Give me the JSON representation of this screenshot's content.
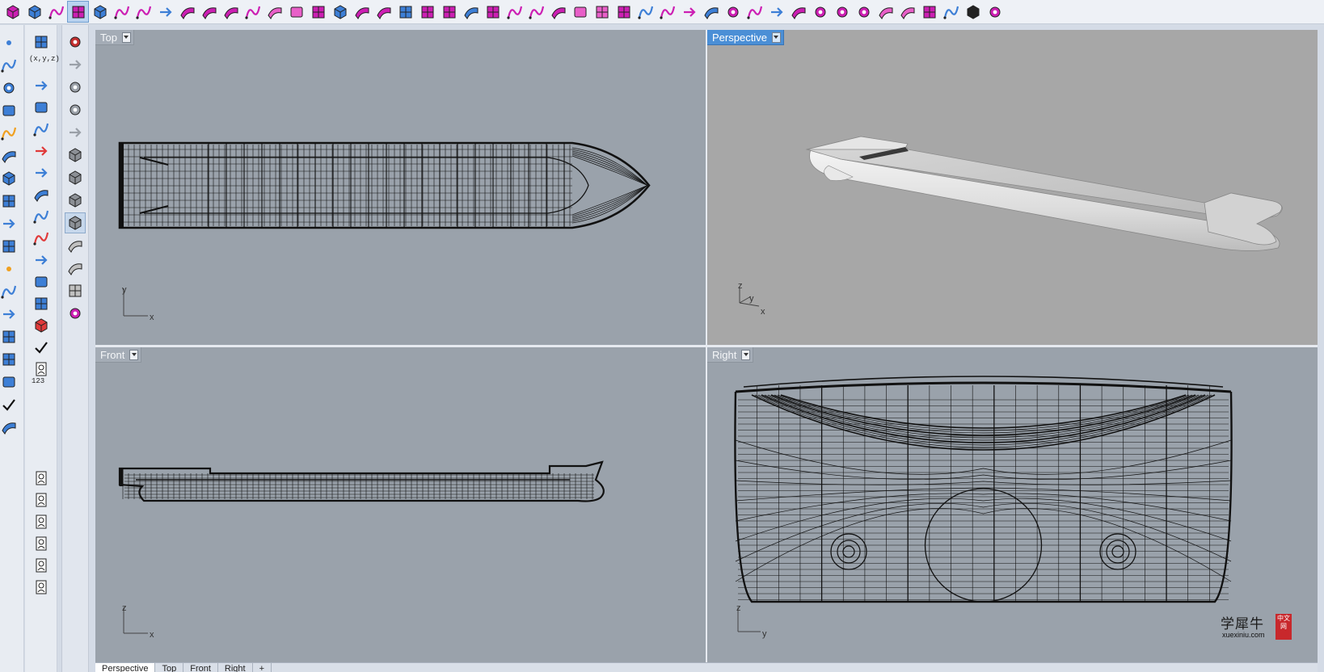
{
  "viewports": {
    "top": {
      "label": "Top",
      "axis_x": "x",
      "axis_y": "y"
    },
    "perspective": {
      "label": "Perspective",
      "axis_x": "x",
      "axis_y": "y",
      "axis_z": "z"
    },
    "front": {
      "label": "Front",
      "axis_x": "x",
      "axis_z": "z"
    },
    "right": {
      "label": "Right",
      "axis_y": "y",
      "axis_z": "z"
    }
  },
  "bottom_tabs": [
    "Perspective",
    "Top",
    "Front",
    "Right",
    "+"
  ],
  "left_toolbar_2": {
    "coord_label": "(x,y,z)",
    "numbers_label": "123"
  },
  "watermark": {
    "text": "学犀牛",
    "url": "xuexiniu.com",
    "seal": "中文网"
  },
  "toolbar_icons": [
    "new-file-icon",
    "open-file-icon",
    "save-icon",
    "print-icon",
    "viewport-icon",
    "curve-icon",
    "surface-icon",
    "solid-icon",
    "mesh-icon",
    "transform-icon",
    "dimension-icon",
    "render-icon",
    "layers-icon",
    "properties-icon",
    "analyze-icon",
    "options-icon"
  ],
  "colors": {
    "accent": "#4b8fd6",
    "viewport_bg": "#9aa2ab",
    "shaded_bg": "#a7a7a7",
    "icon_magenta": "#cc1fb3"
  }
}
